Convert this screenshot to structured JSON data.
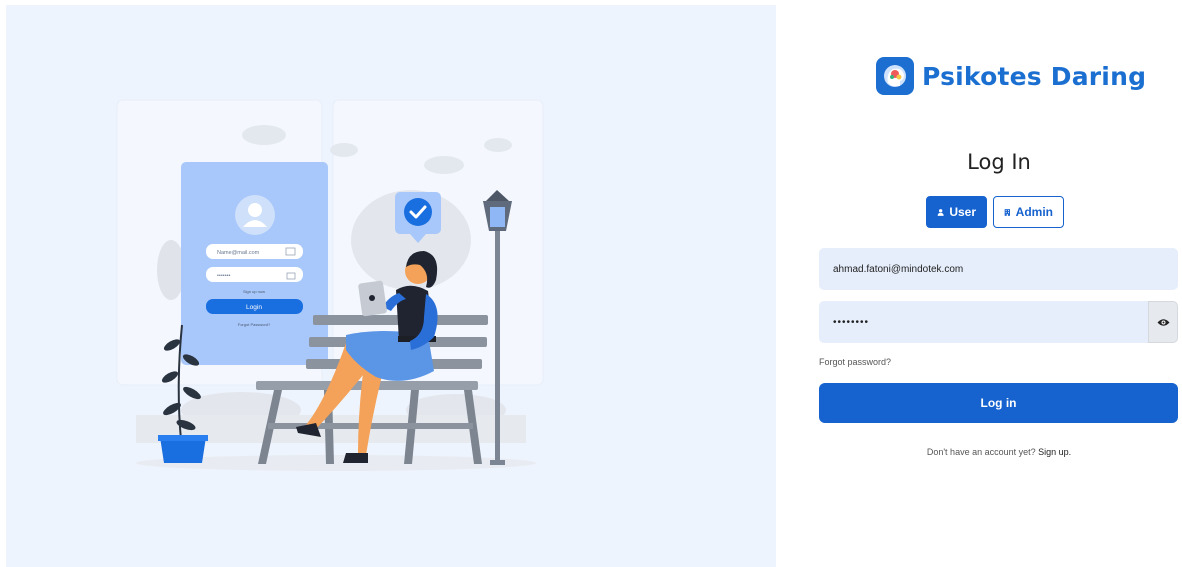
{
  "brand": {
    "name": "Psikotes Daring"
  },
  "illustration": {
    "form_email_placeholder": "Name@mail.com",
    "form_password_dots": "•••••••",
    "form_signup_text": "Sign up now",
    "form_login_label": "Login",
    "form_forgot_text": "Forgot Password?"
  },
  "login": {
    "title": "Log In",
    "roles": {
      "user": "User",
      "admin": "Admin"
    },
    "email_value": "ahmad.fatoni@mindotek.com",
    "password_value": "••••••••",
    "forgot_label": "Forgot password?",
    "submit_label": "Log in",
    "signup_prompt": "Don't have an account yet?",
    "signup_link": "Sign up."
  },
  "colors": {
    "primary": "#1662cf",
    "brand": "#1a6fd0",
    "field_bg": "#e6eefb",
    "left_bg": "#eef4fd"
  }
}
